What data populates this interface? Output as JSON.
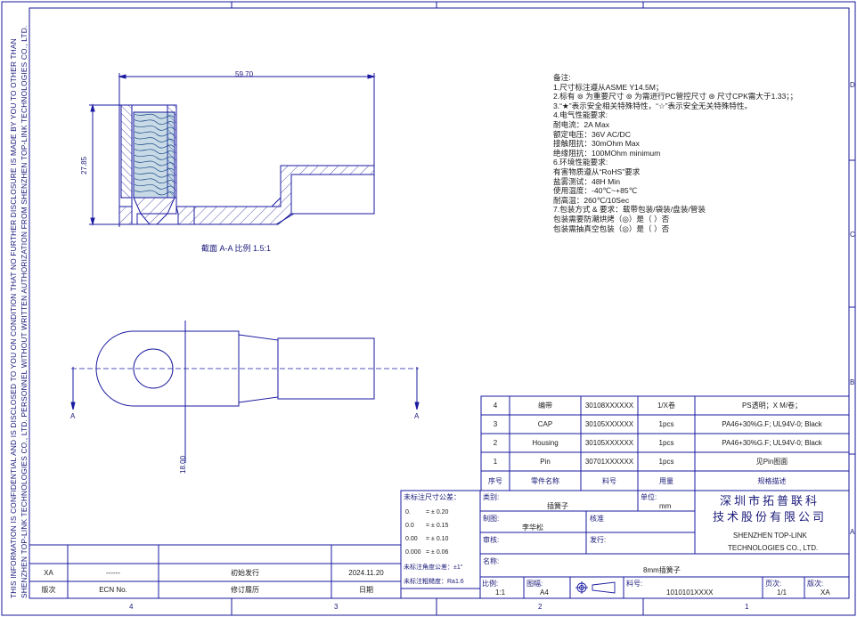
{
  "confidential": {
    "line1": "THIS INFORMATION IS CONFIDENTIAL AND IS DISCLOSED TO YOU ON CONDITION THAT NO FURTHER DISCLOSURE IS MADE BY YOU TO OTHER THAN",
    "line2": "SHENZHEN TOP-LINK TECHNOLOGIES CO., LTD. PERSONNEL WITHOUT WRITTEN AUTHORIZATION FROM SHENZHEN TOP-LINK TECHNOLOGIES CO., LTD."
  },
  "zones": {
    "top": [
      "4",
      "3",
      "2",
      "1"
    ],
    "bottom": [
      "4",
      "3",
      "2",
      "1"
    ],
    "right": [
      "D",
      "C",
      "B",
      "A"
    ]
  },
  "section_view": {
    "dim_length": "59.70",
    "dim_height": "27.85",
    "caption": "截面 A-A   比例 1.5:1"
  },
  "front_view": {
    "dim_width": "18.00",
    "section_mark_left": "A",
    "section_mark_right": "A"
  },
  "notes": [
    "备注:",
    "1.尺寸标注遵从ASME Y14.5M；",
    "2.标有 ⊚ 为重要尺寸 ⊚ 为需进行PC管控尺寸 ⊛ 尺寸CPK需大于1.33；；",
    "3.“★”表示安全相关特殊特性，“☆”表示安全无关特殊特性。",
    "4.电气性能要求:",
    "    耐电流：2A Max",
    "    额定电压：36V AC/DC",
    "    接触阻抗：30mOhm Max",
    "    绝缘阻抗：100MOhm minimum",
    "6.环境性能要求:",
    "    有害物质遵从“RoHS”要求",
    "    盐雾测试：48H Min",
    "    使用温度：-40℃~+85℃",
    "    耐高温：260℃/10Sec",
    "7.包装方式 & 要求：载带包装/袋装/盘装/管装",
    "    包装需要防潮烘烤（◎）是（  ）否",
    "    包装需抽真空包装（◎）是（  ）否"
  ],
  "bom": {
    "headers": {
      "seq": "序号",
      "name": "零件名称",
      "pn": "料号",
      "qty": "用量",
      "spec": "规格描述"
    },
    "rows": [
      {
        "seq": "4",
        "name": "编带",
        "pn": "30108XXXXXX",
        "qty": "1/X卷",
        "spec": "PS透明；X M/卷；"
      },
      {
        "seq": "3",
        "name": "CAP",
        "pn": "30105XXXXXX",
        "qty": "1pcs",
        "spec": "PA46+30%G.F; UL94V-0; Black"
      },
      {
        "seq": "2",
        "name": "Housing",
        "pn": "30105XXXXXX",
        "qty": "1pcs",
        "spec": "PA46+30%G.F; UL94V-0; Black"
      },
      {
        "seq": "1",
        "name": "Pin",
        "pn": "30701XXXXXX",
        "qty": "1pcs",
        "spec": "见Pin图面"
      }
    ]
  },
  "tolerance": {
    "title": "未标注尺寸公差：",
    "rows": [
      {
        "fmt": "0.",
        "val": "= ± 0.20"
      },
      {
        "fmt": "0.0",
        "val": "= ± 0.15"
      },
      {
        "fmt": "0.00",
        "val": "= ± 0.10"
      },
      {
        "fmt": "0.000",
        "val": "= ± 0.06"
      }
    ],
    "angle": "未标注角度公差：±1°",
    "roughness": "未标注粗糙度：Ra1.6"
  },
  "title_block": {
    "category_label": "类别:",
    "category_value": "插簧子",
    "unit_label": "单位:",
    "unit_value": "mm",
    "drawn_label": "制图:",
    "drawn_value": "李华松",
    "check_label": "核准",
    "review_label": "审核:",
    "release_label": "发行:",
    "company_cn_1": "深圳市拓普联科",
    "company_cn_2": "技术股份有限公司",
    "company_en_1": "SHENZHEN TOP-LINK",
    "company_en_2": "TECHNOLOGIES CO., LTD.",
    "name_label": "名称:",
    "name_value": "8mm插簧子",
    "scale_label": "比例:",
    "scale_value": "1:1",
    "size_label": "图幅:",
    "size_value": "A4",
    "pn_label": "料号:",
    "pn_value": "1010101XXXX",
    "page_label": "页次:",
    "page_value": "1/1",
    "rev_label": "版次:",
    "rev_value": "XA"
  },
  "revision": {
    "row": {
      "rev": "XA",
      "ecn": "------",
      "desc": "初始发行",
      "date": "2024.11.20"
    },
    "headers": {
      "rev": "版次",
      "ecn": "ECN No.",
      "desc": "修订履历",
      "date": "日期"
    }
  }
}
